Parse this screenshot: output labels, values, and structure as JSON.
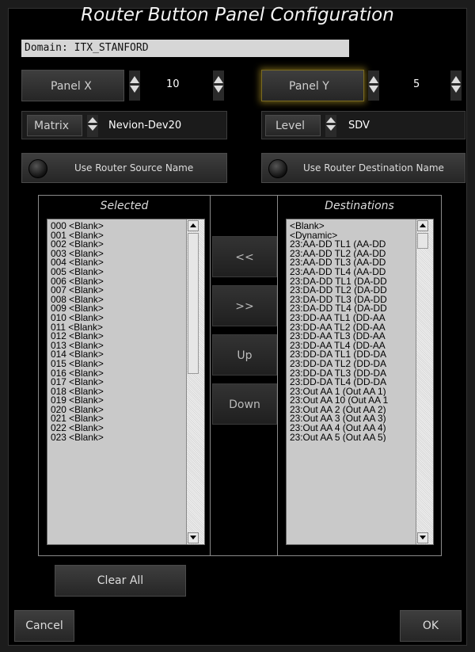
{
  "title": "Router Button Panel Configuration",
  "domain": "Domain: ITX_STANFORD",
  "panel_x": {
    "label": "Panel X",
    "value": "10"
  },
  "panel_y": {
    "label": "Panel Y",
    "value": "5"
  },
  "matrix": {
    "label": "Matrix",
    "value": "Nevion-Dev20"
  },
  "level": {
    "label": "Level",
    "value": "SDV"
  },
  "use_source_label": "Use Router Source Name",
  "use_dest_label": "Use Router Destination Name",
  "selected": {
    "header": "Selected",
    "items": [
      "000 <Blank>",
      "001 <Blank>",
      "002 <Blank>",
      "003 <Blank>",
      "004 <Blank>",
      "005 <Blank>",
      "006 <Blank>",
      "007 <Blank>",
      "008 <Blank>",
      "009 <Blank>",
      "010 <Blank>",
      "011 <Blank>",
      "012 <Blank>",
      "013 <Blank>",
      "014 <Blank>",
      "015 <Blank>",
      "016 <Blank>",
      "017 <Blank>",
      "018 <Blank>",
      "019 <Blank>",
      "020 <Blank>",
      "021 <Blank>",
      "022 <Blank>",
      "023 <Blank>"
    ]
  },
  "destinations": {
    "header": "Destinations",
    "items": [
      "<Blank>",
      "<Dynamic>",
      "23:AA-DD TL1 (AA-DD",
      "23:AA-DD TL2 (AA-DD",
      "23:AA-DD TL3 (AA-DD",
      "23:AA-DD TL4 (AA-DD",
      "23:DA-DD TL1 (DA-DD",
      "23:DA-DD TL2 (DA-DD",
      "23:DA-DD TL3 (DA-DD",
      "23:DA-DD TL4 (DA-DD",
      "23:DD-AA TL1 (DD-AA",
      "23:DD-AA TL2 (DD-AA",
      "23:DD-AA TL3 (DD-AA",
      "23:DD-AA TL4 (DD-AA",
      "23:DD-DA TL1 (DD-DA",
      "23:DD-DA TL2 (DD-DA",
      "23:DD-DA TL3 (DD-DA",
      "23:DD-DA TL4 (DD-DA",
      "23:Out AA 1 (Out AA 1)",
      "23:Out AA 10 (Out AA 1",
      "23:Out AA 2 (Out AA 2)",
      "23:Out AA 3 (Out AA 3)",
      "23:Out AA 4 (Out AA 4)",
      "23:Out AA 5 (Out AA 5)"
    ]
  },
  "buttons": {
    "add": "<<",
    "remove": ">>",
    "up": "Up",
    "down": "Down",
    "clear_all": "Clear All",
    "cancel": "Cancel",
    "ok": "OK"
  }
}
